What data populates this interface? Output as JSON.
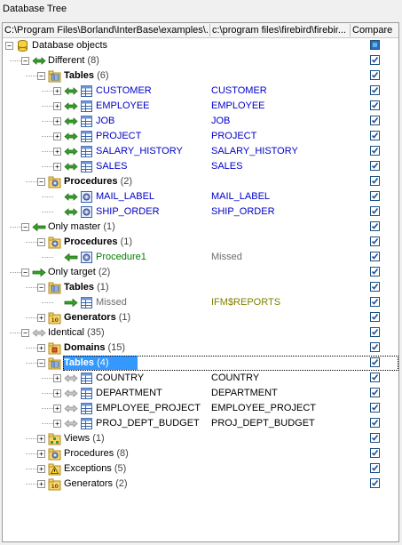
{
  "panel_title": "Database Tree",
  "header": {
    "col1": "C:\\Program Files\\Borland\\InterBase\\examples\\...",
    "col2": "c:\\program files\\firebird\\firebir...",
    "col3": "Compare"
  },
  "rows": [
    {
      "id": "root",
      "label": "Database objects",
      "count": "",
      "right": "",
      "depth": 0,
      "type": "db",
      "expander": "minus",
      "arrow": "",
      "color": "black",
      "bold": false,
      "check": "partial"
    },
    {
      "id": "different",
      "label": "Different",
      "count": "(8)",
      "right": "",
      "depth": 1,
      "type": "group",
      "expander": "minus",
      "arrow": "both-green",
      "color": "black",
      "bold": false,
      "check": "checked"
    },
    {
      "id": "diff-tables",
      "label": "Tables",
      "count": "(6)",
      "right": "",
      "depth": 2,
      "type": "table-folder",
      "expander": "minus",
      "arrow": "",
      "color": "black",
      "bold": true,
      "check": "checked"
    },
    {
      "id": "customer",
      "label": "CUSTOMER",
      "count": "",
      "right": "CUSTOMER",
      "depth": 3,
      "type": "table",
      "expander": "plus",
      "arrow": "both-green",
      "color": "blue",
      "bold": false,
      "check": "checked"
    },
    {
      "id": "employee",
      "label": "EMPLOYEE",
      "count": "",
      "right": "EMPLOYEE",
      "depth": 3,
      "type": "table",
      "expander": "plus",
      "arrow": "both-green",
      "color": "blue",
      "bold": false,
      "check": "checked"
    },
    {
      "id": "job",
      "label": "JOB",
      "count": "",
      "right": "JOB",
      "depth": 3,
      "type": "table",
      "expander": "plus",
      "arrow": "both-green",
      "color": "blue",
      "bold": false,
      "check": "checked"
    },
    {
      "id": "project",
      "label": "PROJECT",
      "count": "",
      "right": "PROJECT",
      "depth": 3,
      "type": "table",
      "expander": "plus",
      "arrow": "both-green",
      "color": "blue",
      "bold": false,
      "check": "checked"
    },
    {
      "id": "salary",
      "label": "SALARY_HISTORY",
      "count": "",
      "right": "SALARY_HISTORY",
      "depth": 3,
      "type": "table",
      "expander": "plus",
      "arrow": "both-green",
      "color": "blue",
      "bold": false,
      "check": "checked"
    },
    {
      "id": "sales",
      "label": "SALES",
      "count": "",
      "right": "SALES",
      "depth": 3,
      "type": "table",
      "expander": "plus",
      "arrow": "both-green",
      "color": "blue",
      "bold": false,
      "check": "checked"
    },
    {
      "id": "diff-procs",
      "label": "Procedures",
      "count": "(2)",
      "right": "",
      "depth": 2,
      "type": "proc-folder",
      "expander": "minus",
      "arrow": "",
      "color": "black",
      "bold": true,
      "check": "checked"
    },
    {
      "id": "mail-label",
      "label": "MAIL_LABEL",
      "count": "",
      "right": "MAIL_LABEL",
      "depth": 3,
      "type": "proc",
      "expander": "",
      "arrow": "both-green",
      "color": "blue",
      "bold": false,
      "check": "checked"
    },
    {
      "id": "ship-order",
      "label": "SHIP_ORDER",
      "count": "",
      "right": "SHIP_ORDER",
      "depth": 3,
      "type": "proc",
      "expander": "",
      "arrow": "both-green",
      "color": "blue",
      "bold": false,
      "check": "checked"
    },
    {
      "id": "only-master",
      "label": "Only master",
      "count": "(1)",
      "right": "",
      "depth": 1,
      "type": "group",
      "expander": "minus",
      "arrow": "left-green",
      "color": "black",
      "bold": false,
      "check": "checked"
    },
    {
      "id": "om-procs",
      "label": "Procedures",
      "count": "(1)",
      "right": "",
      "depth": 2,
      "type": "proc-folder",
      "expander": "minus",
      "arrow": "",
      "color": "black",
      "bold": true,
      "check": "checked"
    },
    {
      "id": "procedure1",
      "label": "Procedure1",
      "count": "",
      "right": "Missed",
      "depth": 3,
      "type": "proc",
      "expander": "",
      "arrow": "left-green",
      "color": "green",
      "bold": false,
      "rightColor": "gray",
      "check": "checked"
    },
    {
      "id": "only-target",
      "label": "Only target",
      "count": "(2)",
      "right": "",
      "depth": 1,
      "type": "group",
      "expander": "minus",
      "arrow": "right-green",
      "color": "black",
      "bold": false,
      "check": "checked"
    },
    {
      "id": "ot-tables",
      "label": "Tables",
      "count": "(1)",
      "right": "",
      "depth": 2,
      "type": "table-folder",
      "expander": "minus",
      "arrow": "",
      "color": "black",
      "bold": true,
      "check": "checked"
    },
    {
      "id": "ifm-reports",
      "label": "Missed",
      "count": "",
      "right": "IFM$REPORTS",
      "depth": 3,
      "type": "table",
      "expander": "",
      "arrow": "right-green",
      "color": "gray",
      "bold": false,
      "rightColor": "olive",
      "check": "checked"
    },
    {
      "id": "ot-generators",
      "label": "Generators",
      "count": "(1)",
      "right": "",
      "depth": 2,
      "type": "gen-folder",
      "expander": "plus",
      "arrow": "",
      "color": "black",
      "bold": true,
      "check": "checked"
    },
    {
      "id": "identical",
      "label": "Identical",
      "count": "(35)",
      "right": "",
      "depth": 1,
      "type": "group",
      "expander": "minus",
      "arrow": "both-gray",
      "color": "black",
      "bold": false,
      "check": "checked"
    },
    {
      "id": "id-domains",
      "label": "Domains",
      "count": "(15)",
      "right": "",
      "depth": 2,
      "type": "domain-folder",
      "expander": "plus",
      "arrow": "",
      "color": "black",
      "bold": true,
      "check": "checked"
    },
    {
      "id": "id-tables",
      "label": "Tables",
      "count": "(4)",
      "right": "",
      "depth": 2,
      "type": "table-folder",
      "expander": "minus",
      "arrow": "",
      "color": "black",
      "bold": true,
      "check": "checked",
      "selected": true
    },
    {
      "id": "country",
      "label": "COUNTRY",
      "count": "",
      "right": "COUNTRY",
      "depth": 3,
      "type": "table",
      "expander": "plus",
      "arrow": "both-gray",
      "color": "black",
      "bold": false,
      "check": "checked"
    },
    {
      "id": "department",
      "label": "DEPARTMENT",
      "count": "",
      "right": "DEPARTMENT",
      "depth": 3,
      "type": "table",
      "expander": "plus",
      "arrow": "both-gray",
      "color": "black",
      "bold": false,
      "check": "checked"
    },
    {
      "id": "employee-project",
      "label": "EMPLOYEE_PROJECT",
      "count": "",
      "right": "EMPLOYEE_PROJECT",
      "depth": 3,
      "type": "table",
      "expander": "plus",
      "arrow": "both-gray",
      "color": "black",
      "bold": false,
      "check": "checked"
    },
    {
      "id": "proj-dept-budget",
      "label": "PROJ_DEPT_BUDGET",
      "count": "",
      "right": "PROJ_DEPT_BUDGET",
      "depth": 3,
      "type": "table",
      "expander": "plus",
      "arrow": "both-gray",
      "color": "black",
      "bold": false,
      "check": "checked"
    },
    {
      "id": "id-views",
      "label": "Views",
      "count": "(1)",
      "right": "",
      "depth": 2,
      "type": "view-folder",
      "expander": "plus",
      "arrow": "",
      "color": "black",
      "bold": false,
      "check": "checked"
    },
    {
      "id": "id-procs",
      "label": "Procedures",
      "count": "(8)",
      "right": "",
      "depth": 2,
      "type": "proc-folder",
      "expander": "plus",
      "arrow": "",
      "color": "black",
      "bold": false,
      "check": "checked"
    },
    {
      "id": "id-exceptions",
      "label": "Exceptions",
      "count": "(5)",
      "right": "",
      "depth": 2,
      "type": "exc-folder",
      "expander": "plus",
      "arrow": "",
      "color": "black",
      "bold": false,
      "check": "checked"
    },
    {
      "id": "id-generators",
      "label": "Generators",
      "count": "(2)",
      "right": "",
      "depth": 2,
      "type": "gen-folder",
      "expander": "plus",
      "arrow": "",
      "color": "black",
      "bold": false,
      "check": "checked"
    }
  ]
}
